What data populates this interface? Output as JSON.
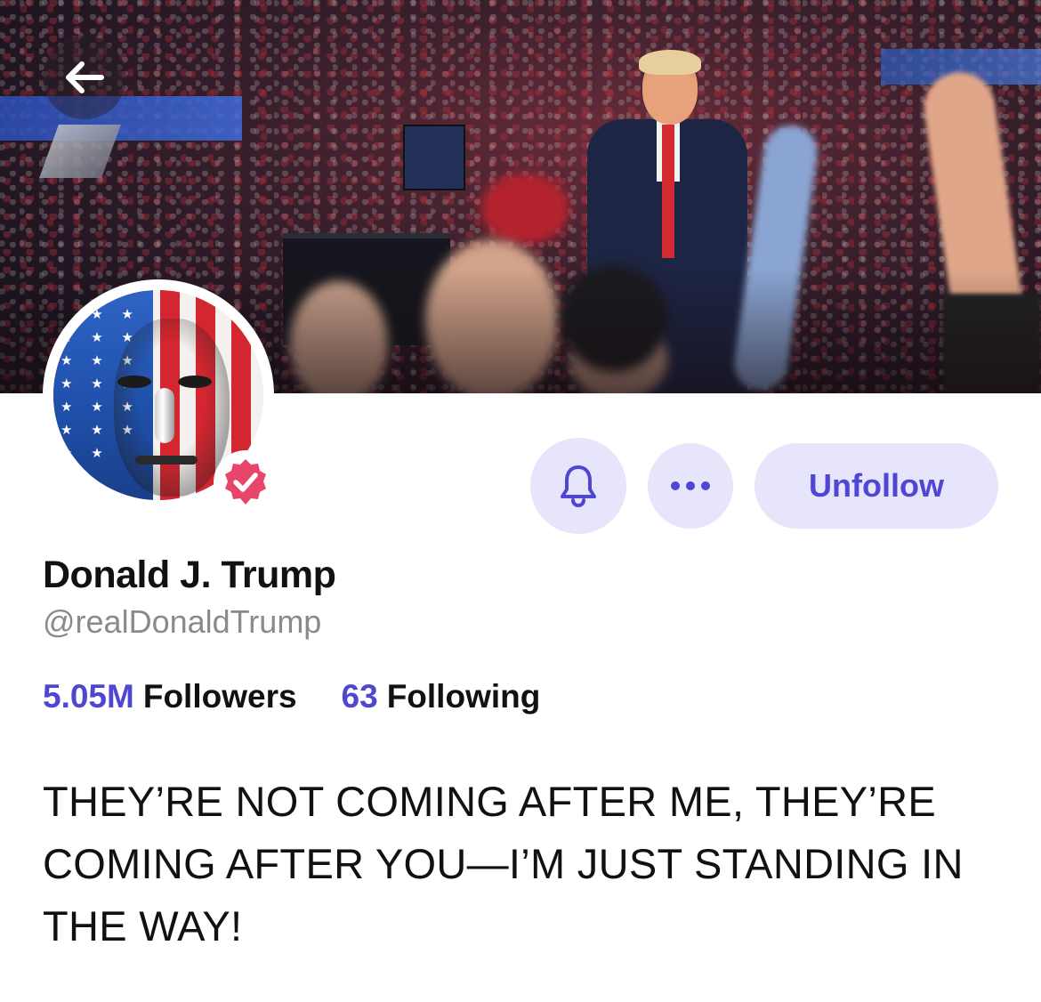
{
  "profile": {
    "display_name": "Donald J. Trump",
    "handle": "@realDonaldTrump",
    "verified": true,
    "bio": "THEY’RE NOT COMING AFTER ME, THEY’RE COMING AFTER YOU—I’M JUST STANDING IN THE WAY!"
  },
  "stats": {
    "followers_count": "5.05M",
    "followers_label": "Followers",
    "following_count": "63",
    "following_label": "Following"
  },
  "actions": {
    "unfollow_label": "Unfollow",
    "notifications_icon": "bell-icon",
    "more_icon": "more-horizontal-icon"
  },
  "nav": {
    "back_icon": "arrow-left-icon"
  },
  "colors": {
    "accent": "#4f47d1",
    "button_bg": "#e7e5fb",
    "verified": "#e8456b",
    "muted_text": "#8a8a8a"
  }
}
